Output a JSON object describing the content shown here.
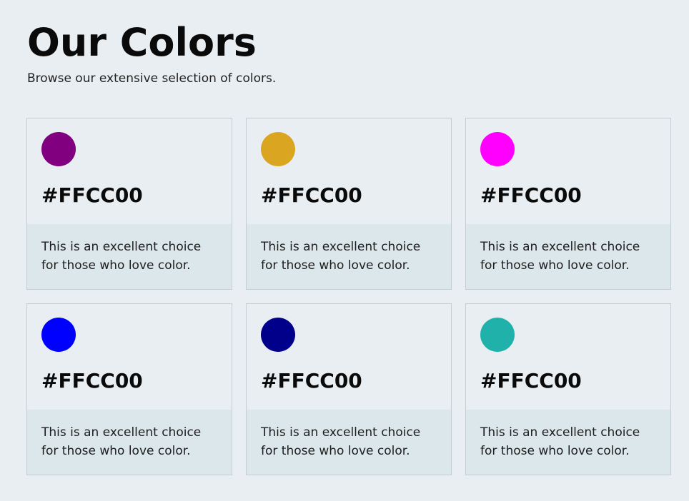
{
  "header": {
    "title": "Our Colors",
    "subtitle": "Browse our extensive selection of colors."
  },
  "cards": [
    {
      "swatch_color": "#800080",
      "hex_label": "#FFCC00",
      "description": "This is an excellent choice for those who love color."
    },
    {
      "swatch_color": "#DAA520",
      "hex_label": "#FFCC00",
      "description": "This is an excellent choice for those who love color."
    },
    {
      "swatch_color": "#FF00FF",
      "hex_label": "#FFCC00",
      "description": "This is an excellent choice for those who love color."
    },
    {
      "swatch_color": "#0000FF",
      "hex_label": "#FFCC00",
      "description": "This is an excellent choice for those who love color."
    },
    {
      "swatch_color": "#00008B",
      "hex_label": "#FFCC00",
      "description": "This is an excellent choice for those who love color."
    },
    {
      "swatch_color": "#20B2AA",
      "hex_label": "#FFCC00",
      "description": "This is an excellent choice for those who love color."
    }
  ]
}
